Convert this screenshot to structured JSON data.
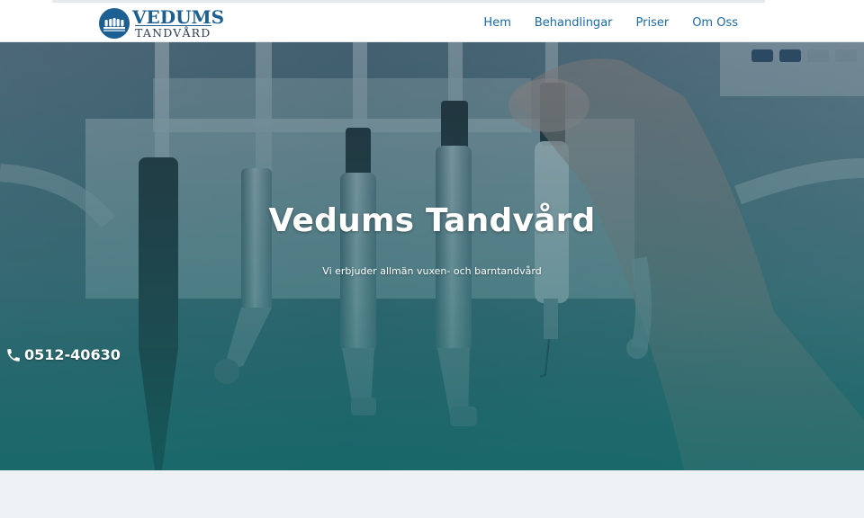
{
  "header": {
    "logo_line1": "VEDUMS",
    "logo_line2": "TANDVÅRD",
    "nav": [
      {
        "label": "Hem"
      },
      {
        "label": "Behandlingar"
      },
      {
        "label": "Priser"
      },
      {
        "label": "Om Oss"
      }
    ]
  },
  "hero": {
    "title": "Vedums Tandvård",
    "subtitle": "Vi erbjuder allmän vuxen- och barntandvård",
    "phone": "0512-40630"
  },
  "colors": {
    "brand": "#1b5f93",
    "nav_link": "#1b6aa6",
    "hero_tint": "#1f6a6d",
    "below_bg": "#edf1f4"
  },
  "icons": {
    "logo": "tooth-row-emblem-icon",
    "phone": "phone-icon"
  }
}
